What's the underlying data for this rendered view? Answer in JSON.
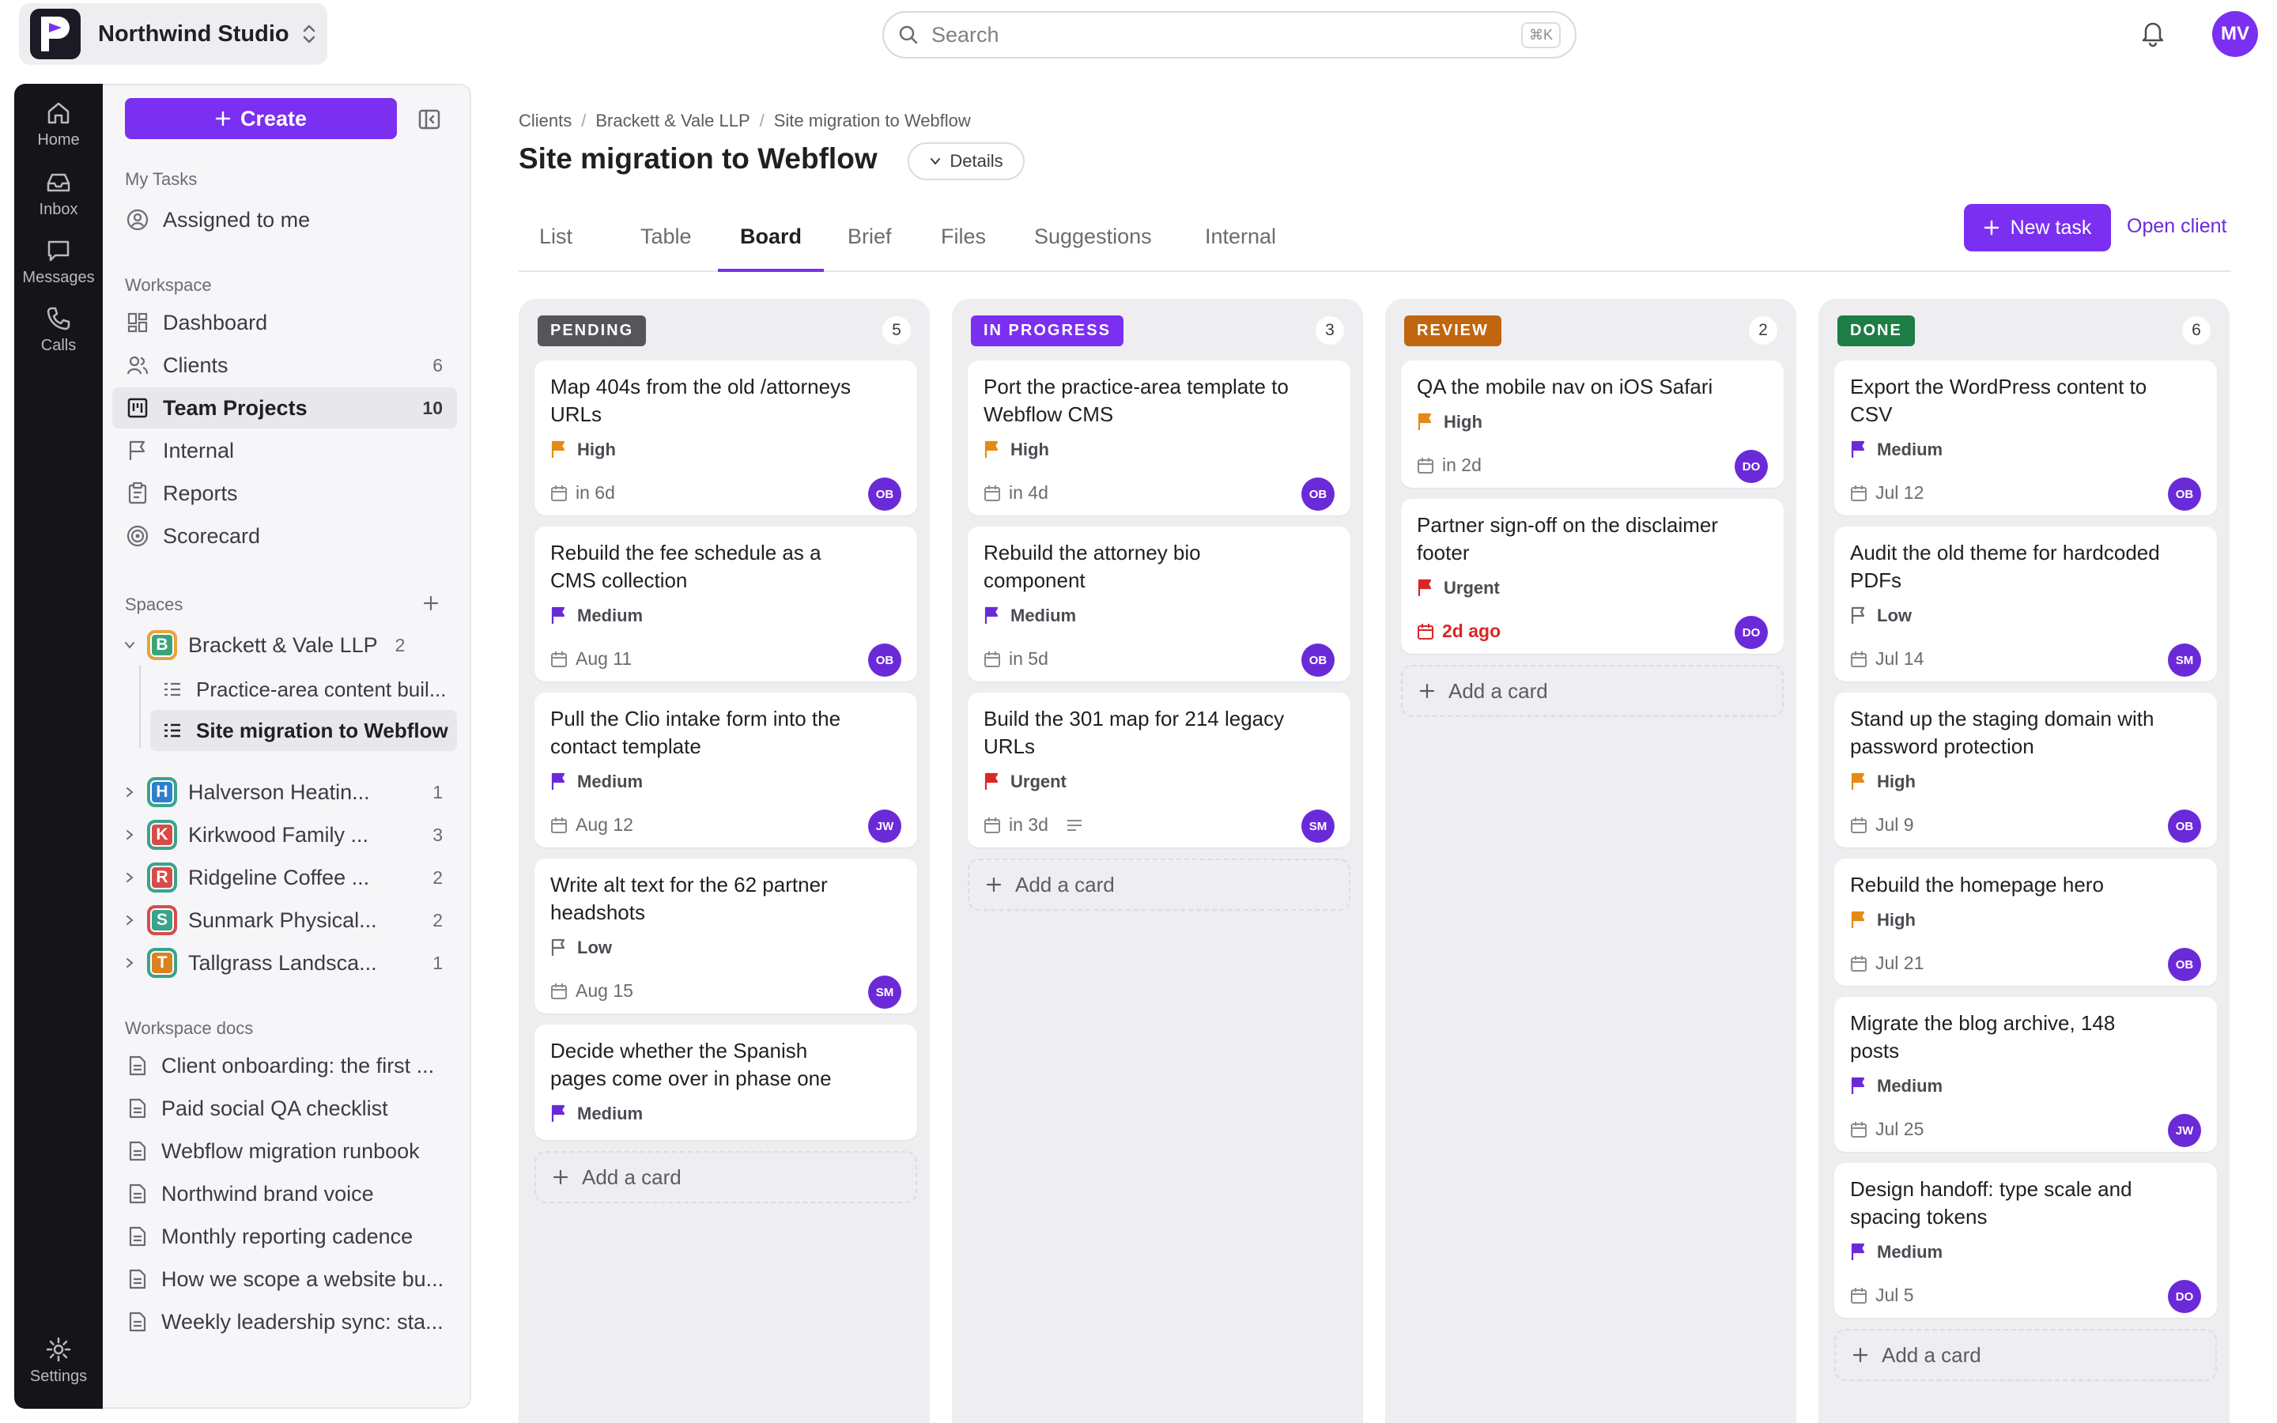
{
  "workspace": {
    "name": "Northwind Studio"
  },
  "search": {
    "placeholder": "Search",
    "shortcut": "⌘K"
  },
  "user": {
    "initials": "MV"
  },
  "rail": {
    "items": [
      "Home",
      "Inbox",
      "Messages",
      "Calls",
      "Settings"
    ]
  },
  "sidebar": {
    "create_label": "Create",
    "my_tasks_label": "My Tasks",
    "assigned": "Assigned to me",
    "workspace_label": "Workspace",
    "nav": [
      {
        "label": "Dashboard",
        "count": ""
      },
      {
        "label": "Clients",
        "count": "6"
      },
      {
        "label": "Team Projects",
        "count": "10"
      },
      {
        "label": "Internal",
        "count": ""
      },
      {
        "label": "Reports",
        "count": ""
      },
      {
        "label": "Scorecard",
        "count": ""
      }
    ],
    "spaces_label": "Spaces",
    "spaces": [
      {
        "letter": "B",
        "label": "Brackett & Vale LLP",
        "count": "2",
        "color": "#3ba37a",
        "border": "#e8a23d"
      },
      {
        "letter": "H",
        "label": "Halverson Heatin...",
        "count": "1",
        "color": "#2f7fd1",
        "border": "#3aa38c"
      },
      {
        "letter": "K",
        "label": "Kirkwood Family ...",
        "count": "3",
        "color": "#d94b4b",
        "border": "#3aa38c"
      },
      {
        "letter": "R",
        "label": "Ridgeline Coffee ...",
        "count": "2",
        "color": "#d94b4b",
        "border": "#3aa38c"
      },
      {
        "letter": "S",
        "label": "Sunmark Physical...",
        "count": "2",
        "color": "#3aa38c",
        "border": "#d94b4b"
      },
      {
        "letter": "T",
        "label": "Tallgrass Landsca...",
        "count": "1",
        "color": "#d9821f",
        "border": "#3aa38c"
      }
    ],
    "subprojects": [
      "Practice-area content buil...",
      "Site migration to Webflow"
    ],
    "docs_label": "Workspace docs",
    "docs": [
      "Client onboarding: the first ...",
      "Paid social QA checklist",
      "Webflow migration runbook",
      "Northwind brand voice",
      "Monthly reporting cadence",
      "How we scope a website bu...",
      "Weekly leadership sync: sta..."
    ]
  },
  "breadcrumb": [
    "Clients",
    "Brackett & Vale LLP",
    "Site migration to Webflow"
  ],
  "page": {
    "title": "Site migration to Webflow",
    "details_label": "Details"
  },
  "tabs": [
    "List",
    "Table",
    "Board",
    "Brief",
    "Files",
    "Suggestions",
    "Internal"
  ],
  "active_tab": "Board",
  "actions": {
    "new_task": "New task",
    "open_client": "Open client"
  },
  "add_card_label": "Add a card",
  "priority_colors": {
    "High": "#e58a16",
    "Medium": "#6b2ad8",
    "Urgent": "#d92626",
    "Low": "#6b6b72"
  },
  "columns": [
    {
      "status": "PENDING",
      "count": "5",
      "color": "#55555c",
      "cards": [
        {
          "title": "Map 404s from the old /attorneys URLs",
          "priority": "High",
          "due": "in 6d",
          "assignee": "OB"
        },
        {
          "title": "Rebuild the fee schedule as a CMS collection",
          "priority": "Medium",
          "due": "Aug 11",
          "assignee": "OB"
        },
        {
          "title": "Pull the Clio intake form into the contact template",
          "priority": "Medium",
          "due": "Aug 12",
          "assignee": "JW"
        },
        {
          "title": "Write alt text for the 62 partner headshots",
          "priority": "Low",
          "due": "Aug 15",
          "assignee": "SM"
        },
        {
          "title": "Decide whether the Spanish pages come over in phase one",
          "priority": "Medium",
          "due": "",
          "assignee": ""
        }
      ]
    },
    {
      "status": "IN PROGRESS",
      "count": "3",
      "color": "#7b2ff0",
      "cards": [
        {
          "title": "Port the practice-area template to Webflow CMS",
          "priority": "High",
          "due": "in 4d",
          "assignee": "OB"
        },
        {
          "title": "Rebuild the attorney bio component",
          "priority": "Medium",
          "due": "in 5d",
          "assignee": "OB"
        },
        {
          "title": "Build the 301 map for 214 legacy URLs",
          "priority": "Urgent",
          "due": "in 3d",
          "assignee": "SM"
        }
      ]
    },
    {
      "status": "REVIEW",
      "count": "2",
      "color": "#c0660e",
      "cards": [
        {
          "title": "QA the mobile nav on iOS Safari",
          "priority": "High",
          "due": "in 2d",
          "assignee": "DO"
        },
        {
          "title": "Partner sign-off on the disclaimer footer",
          "priority": "Urgent",
          "due": "2d ago",
          "assignee": "DO"
        }
      ]
    },
    {
      "status": "DONE",
      "count": "6",
      "color": "#1e7d45",
      "cards": [
        {
          "title": "Export the WordPress content to CSV",
          "priority": "Medium",
          "due": "Jul 12",
          "assignee": "OB"
        },
        {
          "title": "Audit the old theme for hardcoded PDFs",
          "priority": "Low",
          "due": "Jul 14",
          "assignee": "SM"
        },
        {
          "title": "Stand up the staging domain with password protection",
          "priority": "High",
          "due": "Jul 9",
          "assignee": "OB"
        },
        {
          "title": "Rebuild the homepage hero",
          "priority": "High",
          "due": "Jul 21",
          "assignee": "OB"
        },
        {
          "title": "Migrate the blog archive, 148 posts",
          "priority": "Medium",
          "due": "Jul 25",
          "assignee": "JW"
        },
        {
          "title": "Design handoff: type scale and spacing tokens",
          "priority": "Medium",
          "due": "Jul 5",
          "assignee": "DO"
        }
      ]
    }
  ]
}
